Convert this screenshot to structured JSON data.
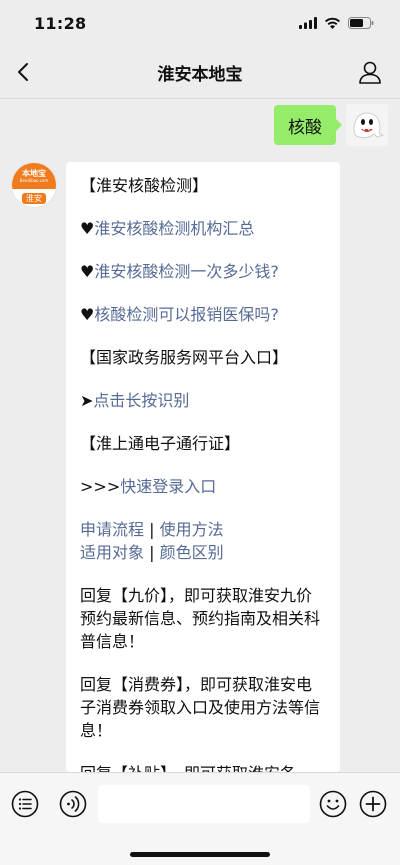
{
  "status": {
    "time": "11:28"
  },
  "header": {
    "title": "淮安本地宝"
  },
  "outgoing": {
    "text": "核酸"
  },
  "bot_avatar": {
    "logo": "本地宝",
    "sub": "Bendibao.com",
    "city": "淮安"
  },
  "message": {
    "title": "【淮安核酸检测】",
    "link1": "淮安核酸检测机构汇总",
    "link2": "淮安核酸检测一次多少钱?",
    "link3": "核酸检测可以报销医保吗?",
    "section2": "【国家政务服务网平台入口】",
    "arrow": "➤",
    "link4": "点击长按识别",
    "section3": "【淮上通电子通行证】",
    "prefix5": ">>>",
    "link5": "快速登录入口",
    "link6a": "申请流程",
    "link6b": "使用方法",
    "link7a": "适用对象",
    "link7b": "颜色区别",
    "sep": " | ",
    "reply1": "回复【九价】，即可获取淮安九价预约最新信息、预约指南及相关科普信息！",
    "reply2": "回复【消费券】，即可获取淮安电子消费券领取入口及使用方法等信息！",
    "reply3": "回复【补贴】，即可获取淮安各"
  },
  "icons": {
    "heart": "♥"
  }
}
